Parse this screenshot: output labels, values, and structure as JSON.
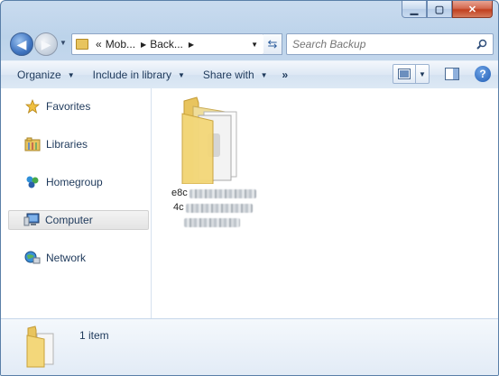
{
  "window": {
    "caption_buttons": {
      "minimize": "▁",
      "maximize": "▢",
      "close": "✕"
    }
  },
  "address": {
    "overflow": "«",
    "crumbs": [
      "Mob...",
      "Back..."
    ]
  },
  "search": {
    "placeholder": "Search Backup"
  },
  "toolbar": {
    "organize": "Organize",
    "include": "Include in library",
    "share": "Share with",
    "more": "»",
    "help": "?"
  },
  "nav": {
    "items": [
      {
        "label": "Favorites",
        "icon": "star-icon"
      },
      {
        "label": "Libraries",
        "icon": "libraries-icon"
      },
      {
        "label": "Homegroup",
        "icon": "homegroup-icon"
      },
      {
        "label": "Computer",
        "icon": "computer-icon",
        "selected": true
      },
      {
        "label": "Network",
        "icon": "network-icon"
      }
    ]
  },
  "content": {
    "items": [
      {
        "name_line1": "e8c",
        "name_line2": "4c"
      }
    ]
  },
  "details": {
    "count": "1 item"
  },
  "colors": {
    "folder": "#e8c45e",
    "selection": "#e4e4e4",
    "text": "#1e395b"
  }
}
